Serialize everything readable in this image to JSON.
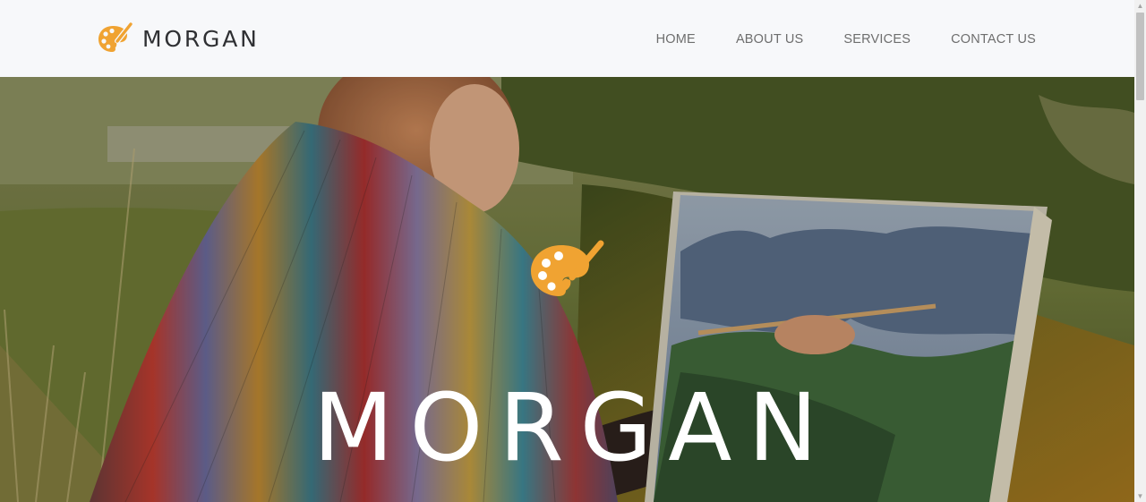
{
  "header": {
    "brand_name": "MORGAN",
    "logo_icon": "palette-brush-icon",
    "nav": [
      {
        "label": "HOME"
      },
      {
        "label": "ABOUT US"
      },
      {
        "label": "SERVICES"
      },
      {
        "label": "CONTACT US"
      }
    ]
  },
  "hero": {
    "title": "MORGAN",
    "icon": "palette-brush-icon",
    "background_image": "woman-painting-landscape-outdoors"
  },
  "colors": {
    "accent": "#f0a332",
    "header_bg": "#f7f8fa",
    "nav_text": "#6e6e6e",
    "brand_text": "#2f3033",
    "hero_text": "#ffffff"
  },
  "scrollbar": {
    "up_icon": "scroll-up-arrow-icon",
    "down_icon": "scroll-down-arrow-icon"
  }
}
